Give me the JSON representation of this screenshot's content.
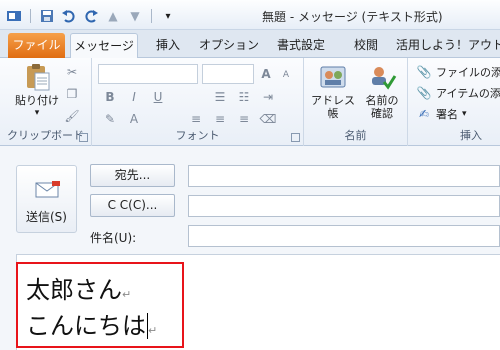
{
  "window": {
    "title": "無題 - メッセージ (テキスト形式)"
  },
  "tabs": [
    {
      "label": "ファイル"
    },
    {
      "label": "メッセージ"
    },
    {
      "label": "挿入"
    },
    {
      "label": "オプション"
    },
    {
      "label": "書式設定"
    },
    {
      "label": "校閲"
    },
    {
      "label": "活用しよう！アウトル"
    }
  ],
  "ribbon": {
    "clipboard": {
      "label": "クリップボード",
      "paste_label": "貼り付け"
    },
    "font": {
      "label": "フォント",
      "bold": "B",
      "italic": "I",
      "underline": "U",
      "grow": "A",
      "shrink": "A"
    },
    "names": {
      "label": "名前",
      "address_book": "アドレス帳",
      "check_names_line1": "名前の",
      "check_names_line2": "確認"
    },
    "insert": {
      "label": "挿入",
      "attach_file": "ファイルの添付",
      "attach_item": "アイテムの添付",
      "signature": "署名"
    }
  },
  "header": {
    "send_label": "送信(S)",
    "to_button": "宛先...",
    "cc_button": "C C(C)...",
    "subject_label": "件名(U):",
    "to_value": "",
    "cc_value": "",
    "subject_value": ""
  },
  "body": {
    "line1": "太郎さん",
    "line2": "こんにちは"
  },
  "colors": {
    "file_tab": "#e06d12",
    "highlight": "#e8141a",
    "accent": "#2b79d0"
  }
}
